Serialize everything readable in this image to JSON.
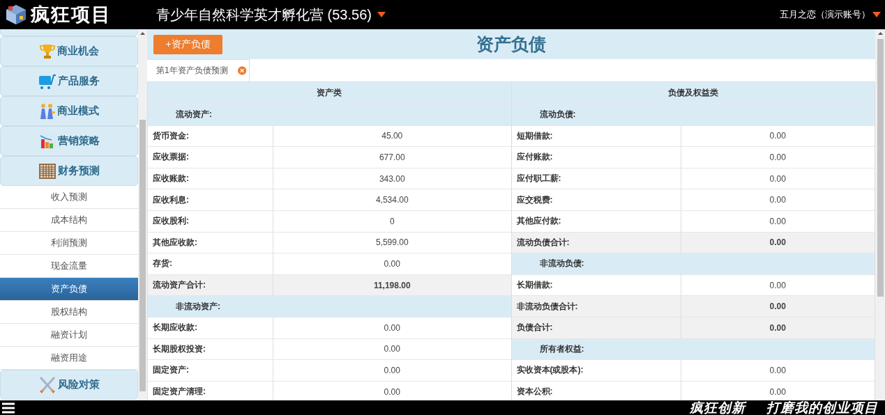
{
  "header": {
    "logo": "疯狂项目",
    "project": "青少年自然科学英才孵化营 (53.56)",
    "user": "五月之恋（演示账号）"
  },
  "sidebar": {
    "items": [
      {
        "kind": "group",
        "label": "商业机会",
        "selected": false
      },
      {
        "kind": "group",
        "label": "产品服务",
        "selected": false
      },
      {
        "kind": "group",
        "label": "商业模式",
        "selected": false
      },
      {
        "kind": "group",
        "label": "营销策略",
        "selected": false
      },
      {
        "kind": "group",
        "label": "财务预测",
        "selected": false
      },
      {
        "kind": "sub",
        "label": "收入预测",
        "selected": false
      },
      {
        "kind": "sub",
        "label": "成本结构",
        "selected": false
      },
      {
        "kind": "sub",
        "label": "利润预测",
        "selected": false
      },
      {
        "kind": "sub",
        "label": "现金流量",
        "selected": false
      },
      {
        "kind": "sub",
        "label": "资产负债",
        "selected": true
      },
      {
        "kind": "sub",
        "label": "股权结构",
        "selected": false
      },
      {
        "kind": "sub",
        "label": "融资计划",
        "selected": false
      },
      {
        "kind": "sub",
        "label": "融资用途",
        "selected": false
      },
      {
        "kind": "group",
        "label": "风险对策",
        "selected": false
      }
    ]
  },
  "page": {
    "add_button": "+资产负债",
    "title": "资产负债"
  },
  "tabs": [
    {
      "label": "第1年资产负债预测",
      "selected": true
    }
  ],
  "table": {
    "columns": [
      "资产类",
      "负债及权益类"
    ],
    "left_rows": [
      {
        "kind": "section",
        "label": "流动资产:"
      },
      {
        "kind": "item",
        "label": "货币资金:",
        "value": "45.00"
      },
      {
        "kind": "item",
        "label": "应收票据:",
        "value": "677.00"
      },
      {
        "kind": "item",
        "label": "应收账款:",
        "value": "343.00"
      },
      {
        "kind": "item",
        "label": "应收利息:",
        "value": "4,534.00"
      },
      {
        "kind": "item",
        "label": "应收股利:",
        "value": "0"
      },
      {
        "kind": "item",
        "label": "其他应收款:",
        "value": "5,599.00"
      },
      {
        "kind": "item",
        "label": "存货:",
        "value": "0.00"
      },
      {
        "kind": "total",
        "label": "流动资产合计:",
        "value": "11,198.00"
      },
      {
        "kind": "section",
        "label": "非流动资产:"
      },
      {
        "kind": "item",
        "label": "长期应收款:",
        "value": "0.00"
      },
      {
        "kind": "item",
        "label": "长期股权投资:",
        "value": "0.00"
      },
      {
        "kind": "item",
        "label": "固定资产:",
        "value": "0.00"
      },
      {
        "kind": "item",
        "label": "固定资产清理:",
        "value": "0.00"
      }
    ],
    "right_rows": [
      {
        "kind": "section",
        "label": "流动负债:"
      },
      {
        "kind": "item",
        "label": "短期借款:",
        "value": "0.00"
      },
      {
        "kind": "item",
        "label": "应付账款:",
        "value": "0.00"
      },
      {
        "kind": "item",
        "label": "应付职工薪:",
        "value": "0.00"
      },
      {
        "kind": "item",
        "label": "应交税费:",
        "value": "0.00"
      },
      {
        "kind": "item",
        "label": "其他应付款:",
        "value": "0.00"
      },
      {
        "kind": "total",
        "label": "流动负债合计:",
        "value": "0.00"
      },
      {
        "kind": "section",
        "label": "非流动负债:"
      },
      {
        "kind": "item",
        "label": "长期借款:",
        "value": "0.00"
      },
      {
        "kind": "total",
        "label": "非流动负债合计:",
        "value": "0.00"
      },
      {
        "kind": "total",
        "label": "负债合计:",
        "value": "0.00"
      },
      {
        "kind": "section",
        "label": "所有者权益:"
      },
      {
        "kind": "item",
        "label": "实收资本(或股本):",
        "value": "0.00"
      },
      {
        "kind": "item",
        "label": "资本公积:",
        "value": "0.00"
      }
    ]
  },
  "footer": {
    "slogans": [
      "疯狂创新",
      "打磨我的创业项目"
    ]
  }
}
